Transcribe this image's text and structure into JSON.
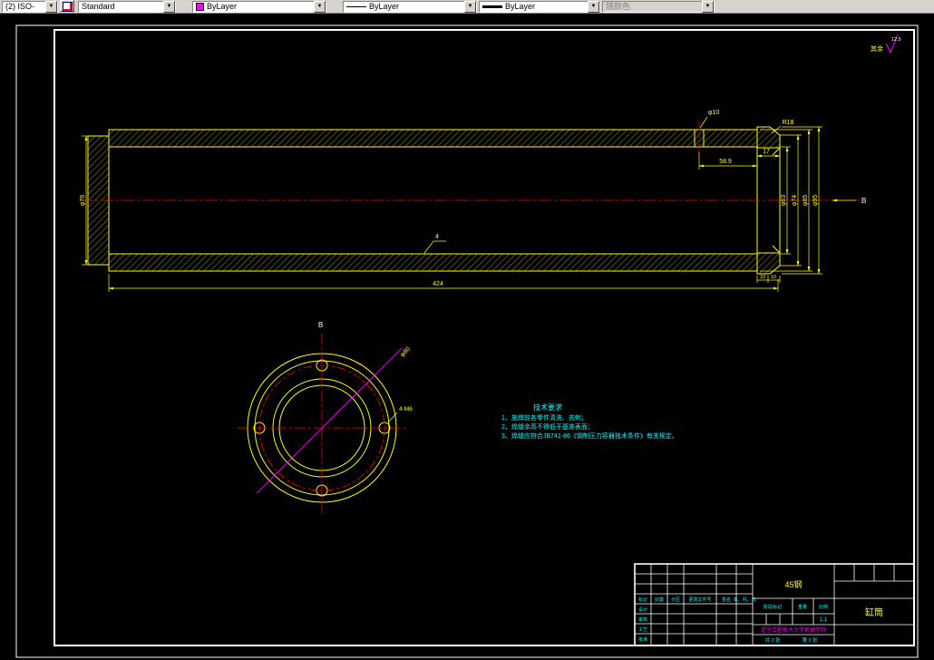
{
  "toolbar": {
    "dim_style": "(2) ISO-",
    "text_style": "Standard",
    "color": "ByLayer",
    "color_swatch": "#ff00ff",
    "linetype": "ByLayer",
    "lineweight": "ByLayer",
    "plot_style": "随颜色",
    "chevron": "▼"
  },
  "annotations": {
    "surface_note": "其余",
    "roughness": "12.5",
    "section_label": "B",
    "view_label": "B",
    "weld_size": "4"
  },
  "dims": {
    "length": "424",
    "flange_offset": "58.9",
    "flange_width": "17",
    "hole_dia": "φ10",
    "fillet": "R18",
    "left_dia": "φ76",
    "bore_dia": "φ63",
    "dia_74": "φ74",
    "dia_85": "φ85",
    "dia_95": "φ95",
    "ten_a": "10",
    "ten_b": "10",
    "bolt_circle_dia": "φ80",
    "bolt_holes": "4-M6"
  },
  "tech_req": {
    "title": "技术要求",
    "lines": [
      "1、施焊前各零件清洗、去刺；",
      "2、焊缝余高不得低于基准表面；",
      "3、焊缝应符合JB741-86《钢制压力容器技术条件》有关规定。"
    ]
  },
  "title_block": {
    "material": "45钢",
    "part_name": "缸筒",
    "company": "辽宁工程技术大学机械学院",
    "stage_label": "阶段标记",
    "weight_label": "重量",
    "scale_label": "比例",
    "scale_value": "1:1",
    "sheets_total": "共 2 张",
    "sheet_no": "第 2 张",
    "rev_cols": [
      "标记",
      "处数",
      "分区",
      "更改文件号",
      "签名",
      "年、月、日"
    ],
    "sign_rows": [
      "设计",
      "审核",
      "工艺",
      "批准"
    ]
  }
}
